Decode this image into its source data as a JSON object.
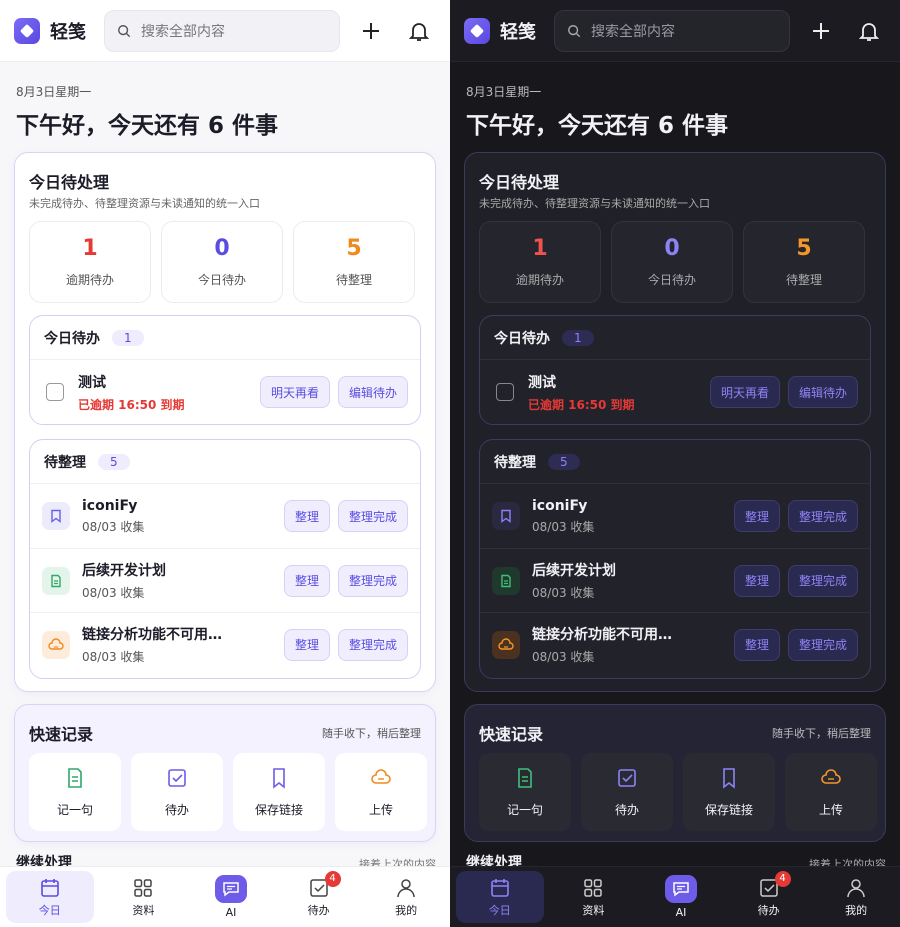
{
  "app": {
    "name": "轻笺"
  },
  "search": {
    "placeholder": "搜索全部内容"
  },
  "date": "8月3日星期一",
  "greeting": "下午好，今天还有 6 件事",
  "todo_card": {
    "title": "今日待处理",
    "subtitle": "未完成待办、待整理资源与未读通知的统一入口",
    "stats": [
      {
        "value": "1",
        "label": "逾期待办",
        "color": "#e53935"
      },
      {
        "value": "0",
        "label": "今日待办",
        "color": "#5a4de0"
      },
      {
        "value": "5",
        "label": "待整理",
        "color": "#f08a1c"
      }
    ],
    "today": {
      "title": "今日待办",
      "count": "1",
      "items": [
        {
          "title": "测试",
          "due": "已逾期 16:50 到期",
          "btn1": "明天再看",
          "btn2": "编辑待办"
        }
      ]
    },
    "sort": {
      "title": "待整理",
      "count": "5",
      "items": [
        {
          "title": "iconiFy",
          "meta": "08/03 收集",
          "icon": "bookmark-icon",
          "btn1": "整理",
          "btn2": "整理完成"
        },
        {
          "title": "后续开发计划",
          "meta": "08/03 收集",
          "icon": "document-icon",
          "btn1": "整理",
          "btn2": "整理完成"
        },
        {
          "title": "链接分析功能不可用…",
          "meta": "08/03 收集",
          "icon": "cloud-icon",
          "btn1": "整理",
          "btn2": "整理完成"
        }
      ]
    }
  },
  "quick": {
    "title": "快速记录",
    "hint": "随手收下，稍后整理",
    "items": [
      {
        "label": "记一句",
        "icon": "note-icon"
      },
      {
        "label": "待办",
        "icon": "checkbox-icon"
      },
      {
        "label": "保存链接",
        "icon": "bookmark-icon"
      },
      {
        "label": "上传",
        "icon": "upload-cloud-icon"
      }
    ]
  },
  "continue": {
    "title": "继续处理",
    "hint": "接着上次的内容"
  },
  "tabs": [
    {
      "label": "今日",
      "icon": "calendar-icon"
    },
    {
      "label": "资料",
      "icon": "grid-icon"
    },
    {
      "label": "AI",
      "icon": "chat-icon"
    },
    {
      "label": "待办",
      "icon": "checklist-icon",
      "badge": "4"
    },
    {
      "label": "我的",
      "icon": "user-icon"
    }
  ],
  "colors": {
    "accent": "#6c5ce7",
    "overdue": "#e53935",
    "pending": "#f08a1c"
  }
}
